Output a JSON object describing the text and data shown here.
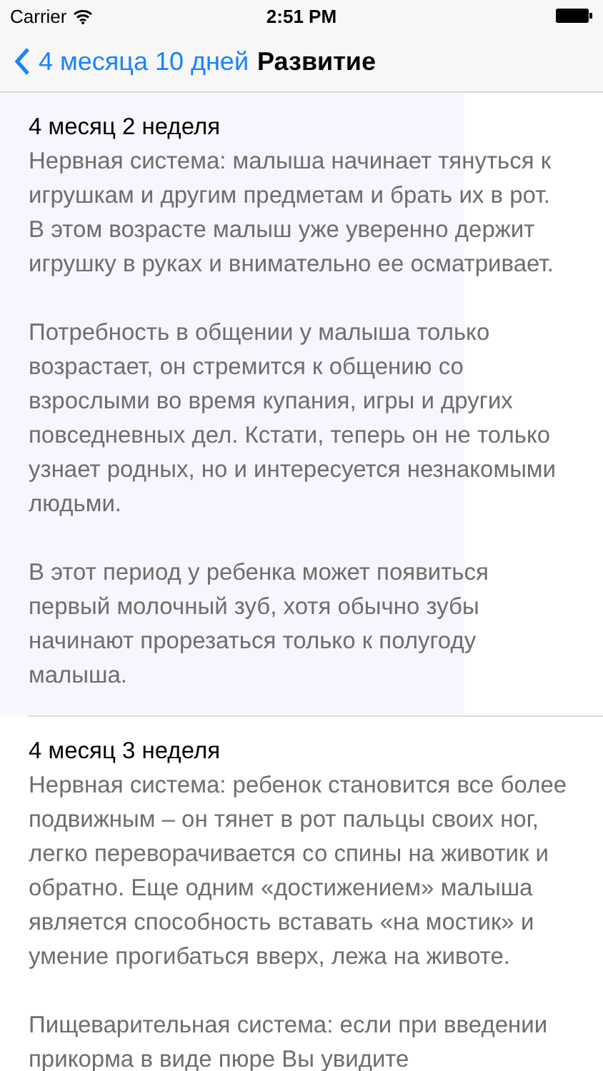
{
  "status_bar": {
    "carrier": "Carrier",
    "time": "2:51 PM"
  },
  "nav_bar": {
    "back": "4 месяца 10 дней",
    "title": "Развитие"
  },
  "sections": [
    {
      "title": "4 месяц 2 неделя",
      "highlighted": true,
      "paragraphs": [
        "Нервная система: малыша начинает тянуться к игрушкам и другим предметам и брать их в рот. В этом возрасте малыш уже уверенно держит игрушку в руках и внимательно ее осматривает.",
        "Потребность в общении у малыша только возрастает, он стремится к общению со взрослыми во время купания, игры и других повседневных дел. Кстати, теперь он не только узнает родных, но и интересуется незнакомыми людьми.",
        "В этот период у ребенка может появиться первый молочный зуб, хотя обычно зубы начинают прорезаться только к полугоду малыша."
      ]
    },
    {
      "title": "4 месяц 3 неделя",
      "highlighted": false,
      "paragraphs": [
        "Нервная система: ребенок становится все более подвижным – он тянет в рот пальцы своих ног, легко переворачивается со спины на животик и обратно. Еще одним «достижением» малыша является способность вставать «на мостик» и умение прогибаться вверх, лежа на животе.",
        "Пищеварительная система: если при введении прикорма в виде пюре Вы увидите"
      ]
    }
  ]
}
